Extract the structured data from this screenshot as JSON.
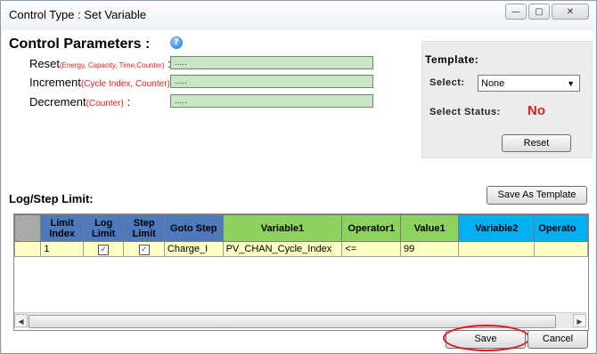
{
  "window": {
    "title": "Control Type : Set Variable",
    "buttons": {
      "minimize": "—",
      "maximize": "▢",
      "close": "✕"
    }
  },
  "control_parameters": {
    "title": "Control Parameters :",
    "help_icon": "?",
    "fields": [
      {
        "label": "Reset",
        "hint": "(Energy, Capacity, Time,Counter)",
        "suffix": ":",
        "value": "....."
      },
      {
        "label": "Increment",
        "hint": "(Cycle Index, Counter)",
        "suffix": ":",
        "value": "....."
      },
      {
        "label": "Decrement",
        "hint": "(Counter)",
        "suffix": ":",
        "value": "....."
      }
    ]
  },
  "template": {
    "title": "Template:",
    "select_label": "Select:",
    "select_value": "None",
    "status_label": "Select Status:",
    "status_value": "No",
    "reset_button": "Reset"
  },
  "log_step": {
    "title": "Log/Step Limit:",
    "save_template_button": "Save As Template"
  },
  "grid": {
    "columns": [
      "",
      "Limit Index",
      "Log Limit",
      "Step Limit",
      "Goto Step",
      "Variable1",
      "Operator1",
      "Value1",
      "Variable2",
      "Operato"
    ],
    "rows": [
      {
        "limit_index": "1",
        "log_limit": true,
        "step_limit": true,
        "goto_step": "Charge_I",
        "variable1": "PV_CHAN_Cycle_Index",
        "operator1": "<=",
        "value1": "99",
        "variable2": "",
        "operator2": ""
      }
    ]
  },
  "footer": {
    "save_button": "Save",
    "cancel_button": "Cancel"
  },
  "colors": {
    "header_blue": "#4e79bd",
    "header_green": "#8dd25e",
    "header_cyan": "#00b0f0",
    "row_yellow": "#fdfdc4",
    "field_green": "#c9e5c6",
    "highlight_red": "#e01818"
  }
}
